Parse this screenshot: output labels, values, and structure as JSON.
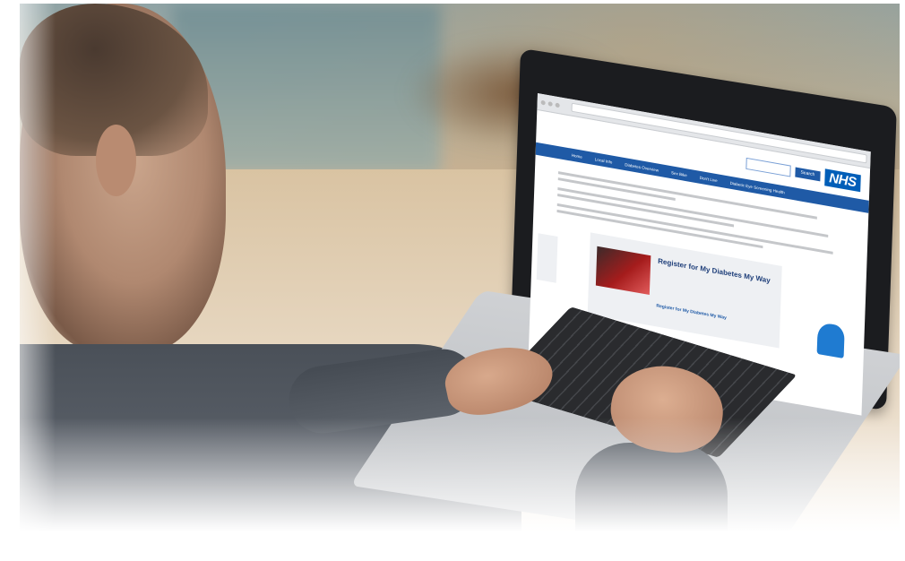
{
  "scene": {
    "description_free": true
  },
  "website": {
    "logo": "NHS",
    "search_button": "Search",
    "nav_items": [
      "Home",
      "Local Info",
      "Diabetes Overview",
      "Sex Bike",
      "Don't Live",
      "Diabetic Eye Screening Health"
    ],
    "promo_title": "Register for My Diabetes My Way",
    "promo_link": "Register for My Diabetes My Way"
  },
  "colors": {
    "nhs_blue": "#005eb8",
    "nav_blue": "#1f5aa6"
  }
}
